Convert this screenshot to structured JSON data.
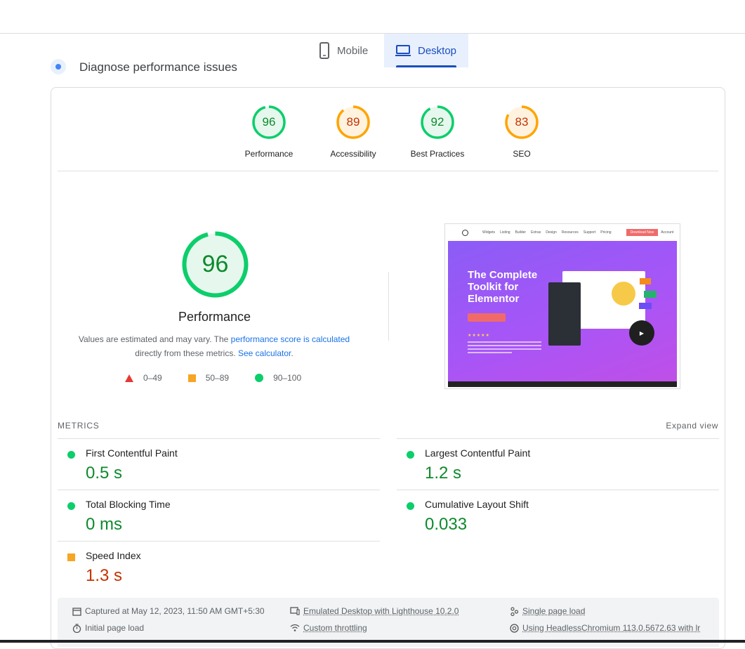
{
  "tabs": [
    {
      "label": "Mobile",
      "icon": "phone-icon"
    },
    {
      "label": "Desktop",
      "icon": "laptop-icon",
      "selected": true
    }
  ],
  "section_title": "Diagnose performance issues",
  "categories": [
    {
      "score": "96",
      "label": "Performance",
      "rating": "good",
      "value": 0.96
    },
    {
      "score": "89",
      "label": "Accessibility",
      "rating": "average",
      "value": 0.89
    },
    {
      "score": "92",
      "label": "Best Practices",
      "rating": "good",
      "value": 0.92
    },
    {
      "score": "83",
      "label": "SEO",
      "rating": "average",
      "value": 0.83
    }
  ],
  "performance": {
    "score": "96",
    "value": 0.96,
    "title": "Performance",
    "desc_prefix": "Values are estimated and may vary. The ",
    "desc_link1": "performance score is calculated",
    "desc_middle": " directly from these metrics. ",
    "desc_link2": "See calculator",
    "desc_suffix": "."
  },
  "legend": [
    {
      "shape": "triangle",
      "color": "#e53935",
      "label": "0–49"
    },
    {
      "shape": "square",
      "color": "#f6a623",
      "label": "50–89"
    },
    {
      "shape": "circle",
      "color": "#0cce6b",
      "label": "90–100"
    }
  ],
  "screenshot": {
    "nav_items": [
      "Widgets",
      "Listing",
      "Builder",
      "Extras",
      "Design",
      "Resources",
      "Support",
      "Pricing"
    ],
    "nav_cta": "Download Now",
    "nav_account": "Account",
    "hero_title": "The Complete Toolkit for Elementor"
  },
  "metrics": {
    "heading": "METRICS",
    "expand_label": "Expand view",
    "left": [
      {
        "name": "First Contentful Paint",
        "value": "0.5 s",
        "rating": "good"
      },
      {
        "name": "Total Blocking Time",
        "value": "0 ms",
        "rating": "good"
      },
      {
        "name": "Speed Index",
        "value": "1.3 s",
        "rating": "average"
      }
    ],
    "right": [
      {
        "name": "Largest Contentful Paint",
        "value": "1.2 s",
        "rating": "good"
      },
      {
        "name": "Cumulative Layout Shift",
        "value": "0.033",
        "rating": "good"
      }
    ]
  },
  "footer": {
    "captured": "Captured at May 12, 2023, 11:50 AM GMT+5:30",
    "initial_load": "Initial page load",
    "emulated": "Emulated Desktop with Lighthouse 10.2.0",
    "throttling": "Custom throttling",
    "single_load": "Single page load",
    "browser": "Using HeadlessChromium 113.0.5672.63 with lr"
  },
  "colors": {
    "good": "#0cce6b",
    "good_text": "#0d8a2c",
    "average": "#ffa400",
    "average_text": "#c33300",
    "accent": "#1a4dbe"
  }
}
